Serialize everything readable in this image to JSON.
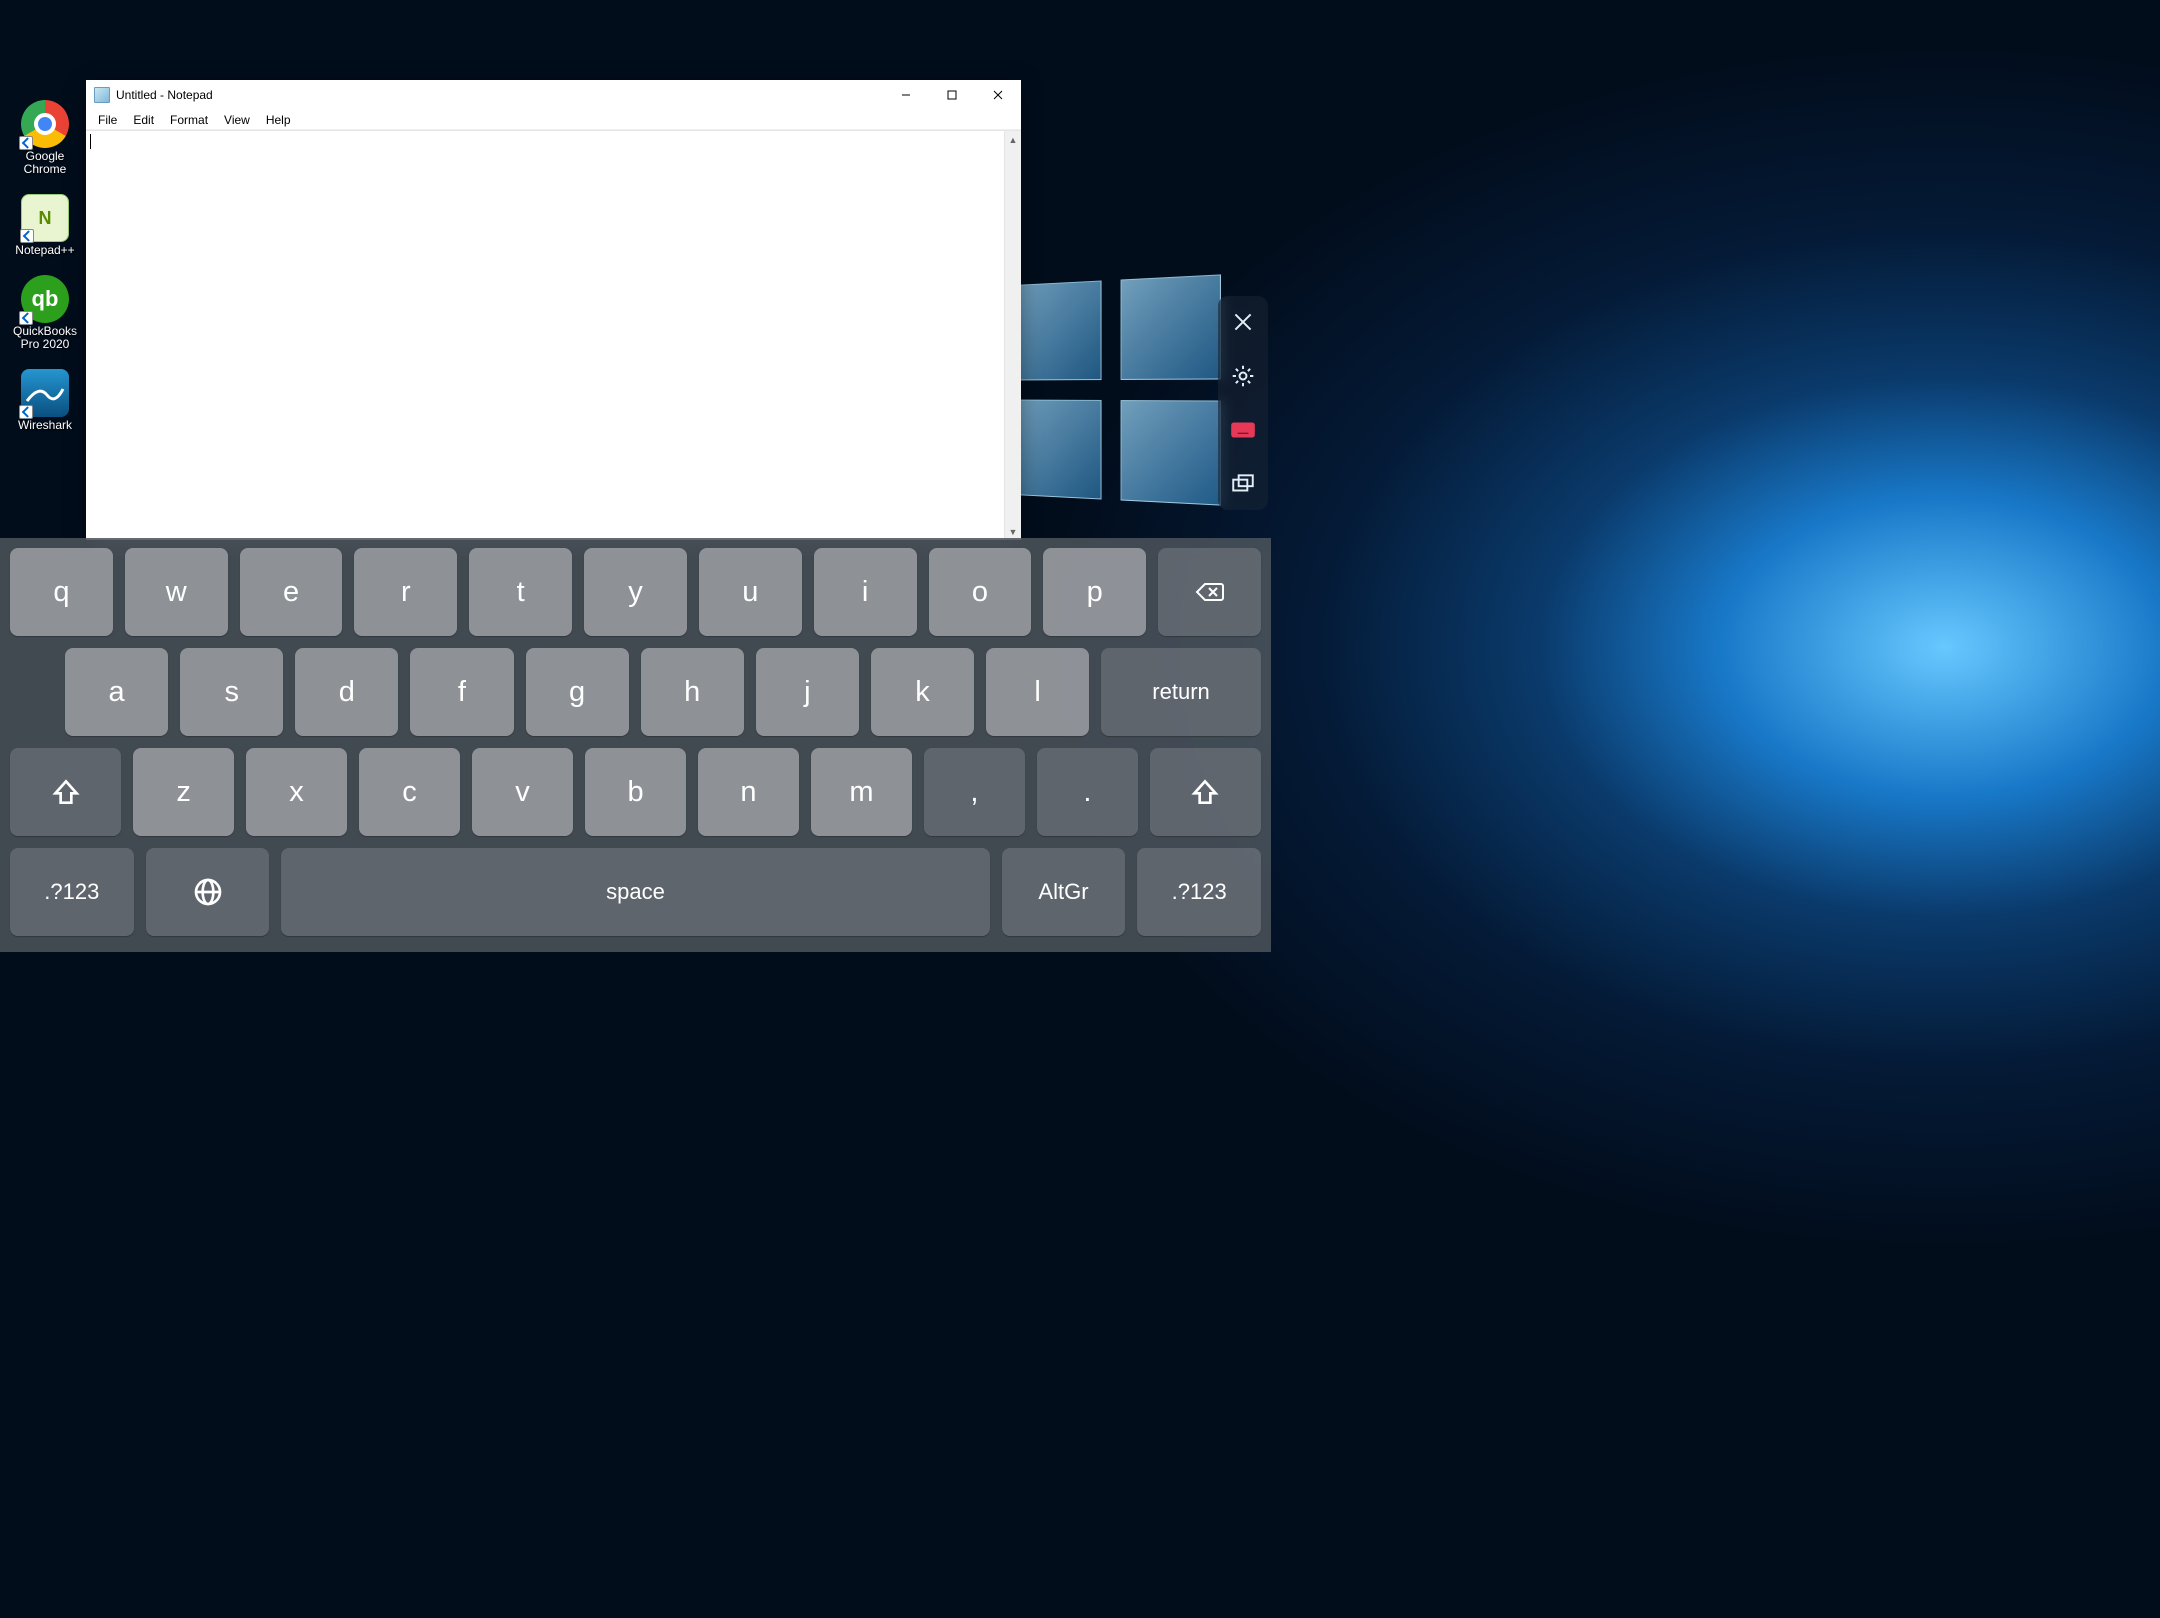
{
  "desktop": {
    "icons": [
      {
        "label": "Google Chrome",
        "name": "google-chrome"
      },
      {
        "label": "Notepad++",
        "name": "notepad-plus-plus"
      },
      {
        "label": "QuickBooks Pro 2020",
        "name": "quickbooks-pro"
      },
      {
        "label": "Wireshark",
        "name": "wireshark"
      }
    ]
  },
  "notepad": {
    "title": "Untitled - Notepad",
    "menus": [
      "File",
      "Edit",
      "Format",
      "View",
      "Help"
    ],
    "content": ""
  },
  "side_toolbar": {
    "close": "close",
    "settings": "settings",
    "keyboard": "keyboard",
    "multimon": "multi-monitor"
  },
  "keyboard": {
    "row1": [
      "q",
      "w",
      "e",
      "r",
      "t",
      "y",
      "u",
      "i",
      "o",
      "p"
    ],
    "row2": [
      "a",
      "s",
      "d",
      "f",
      "g",
      "h",
      "j",
      "k",
      "l"
    ],
    "row3": [
      "z",
      "x",
      "c",
      "v",
      "b",
      "n",
      "m",
      ",",
      "."
    ],
    "backspace": "backspace",
    "return": "return",
    "shift_left": "shift",
    "shift_right": "shift",
    "numsym_left": ".?123",
    "numsym_right": ".?123",
    "globe": "globe",
    "space": "space",
    "altgr": "AltGr"
  }
}
